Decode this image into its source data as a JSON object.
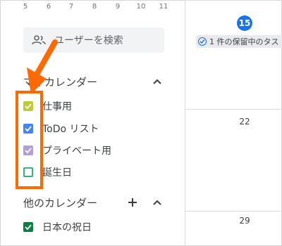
{
  "mini_calendar": {
    "days": [
      "5",
      "6",
      "7",
      "8",
      "9",
      "10",
      "11"
    ]
  },
  "search": {
    "placeholder": "ユーザーを検索"
  },
  "my_calendars": {
    "title": "マイカレンダー",
    "items": [
      {
        "label": "仕事用",
        "color": "#c0ca33",
        "checked": true
      },
      {
        "label": "ToDo リスト",
        "color": "#4285f4",
        "checked": true
      },
      {
        "label": "プライベート用",
        "color": "#b39ddb",
        "checked": true
      },
      {
        "label": "誕生日",
        "color": "#33b679",
        "checked": false
      }
    ]
  },
  "other_calendars": {
    "title": "他のカレンダー",
    "items": [
      {
        "label": "日本の祝日",
        "color": "#0b8043",
        "checked": true
      }
    ]
  },
  "grid": {
    "today": "15",
    "event_chip": "1 件の保留中のタス",
    "day_22": "22",
    "day_29": "29"
  },
  "colors": {
    "highlight": "#ff6a00",
    "today": "#1a73e8"
  }
}
